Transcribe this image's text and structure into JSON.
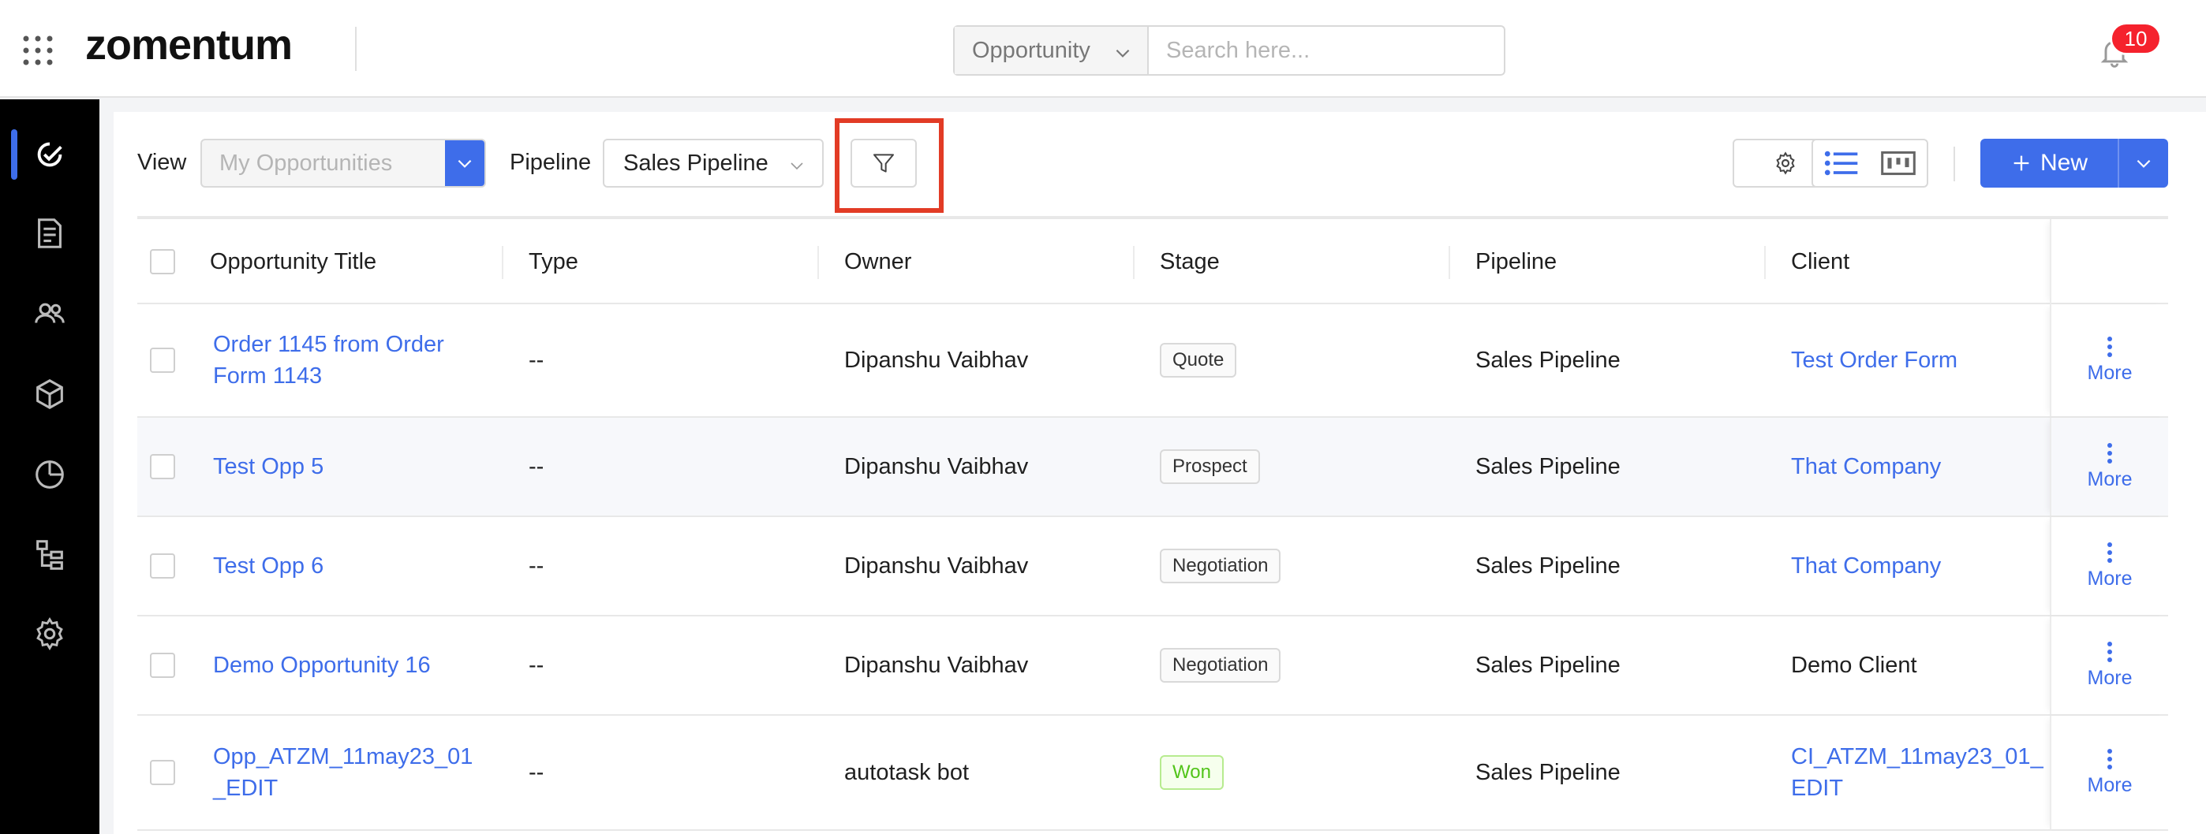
{
  "header": {
    "logo": "zomentum",
    "search_select": "Opportunity",
    "search_placeholder": "Search here...",
    "notification_count": "10"
  },
  "sidebar": {
    "items": [
      "opportunities",
      "documents",
      "clients",
      "products",
      "reports",
      "workflows",
      "settings"
    ]
  },
  "toolbar": {
    "view_label": "View",
    "view_value": "My Opportunities",
    "pipeline_label": "Pipeline",
    "pipeline_value": "Sales Pipeline",
    "new_label": "New"
  },
  "table": {
    "columns": [
      "Opportunity Title",
      "Type",
      "Owner",
      "Stage",
      "Pipeline",
      "Client"
    ],
    "rows": [
      {
        "title": "Order 1145 from Order Form 1143",
        "type": "--",
        "owner": "Dipanshu Vaibhav",
        "stage": "Quote",
        "pipeline": "Sales Pipeline",
        "client": "Test Order Form",
        "client_link": true,
        "more": "More"
      },
      {
        "title": "Test Opp 5",
        "type": "--",
        "owner": "Dipanshu Vaibhav",
        "stage": "Prospect",
        "pipeline": "Sales Pipeline",
        "client": "That Company",
        "client_link": true,
        "more": "More"
      },
      {
        "title": "Test Opp 6",
        "type": "--",
        "owner": "Dipanshu Vaibhav",
        "stage": "Negotiation",
        "pipeline": "Sales Pipeline",
        "client": "That Company",
        "client_link": true,
        "more": "More"
      },
      {
        "title": "Demo Opportunity 16",
        "type": "--",
        "owner": "Dipanshu Vaibhav",
        "stage": "Negotiation",
        "pipeline": "Sales Pipeline",
        "client": "Demo Client",
        "client_link": false,
        "more": "More"
      },
      {
        "title": "Opp_ATZM_11may23_01_EDIT",
        "type": "--",
        "owner": "autotask bot",
        "stage": "Won",
        "pipeline": "Sales Pipeline",
        "client": "CI_ATZM_11may23_01_EDIT",
        "client_link": true,
        "more": "More"
      }
    ]
  },
  "colors": {
    "accent": "#3e6dea",
    "highlight": "#e23b25",
    "badge": "#f5222d",
    "won": "#52c41a"
  }
}
